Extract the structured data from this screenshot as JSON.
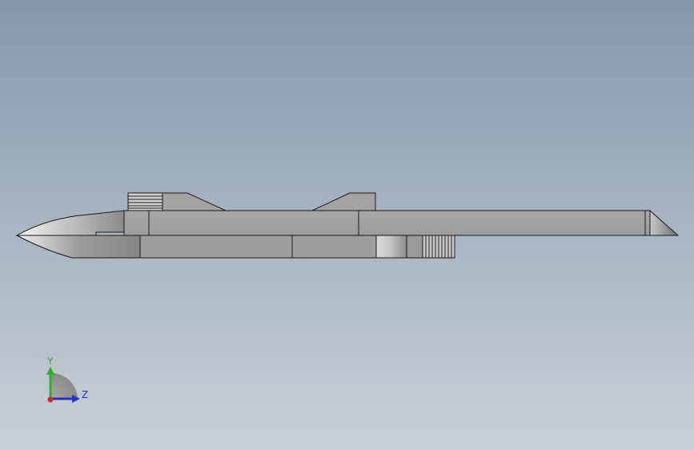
{
  "view": {
    "background_top": "#8597aa",
    "background_bottom": "#c9cfd6"
  },
  "model": {
    "body_color": "#a9a9a9",
    "edge_color": "#1a1a1a"
  },
  "triad": {
    "y_label": "Y",
    "z_label": "Z",
    "y_color": "#2bb32b",
    "z_color": "#2233cc",
    "x_color": "#dd2222"
  }
}
